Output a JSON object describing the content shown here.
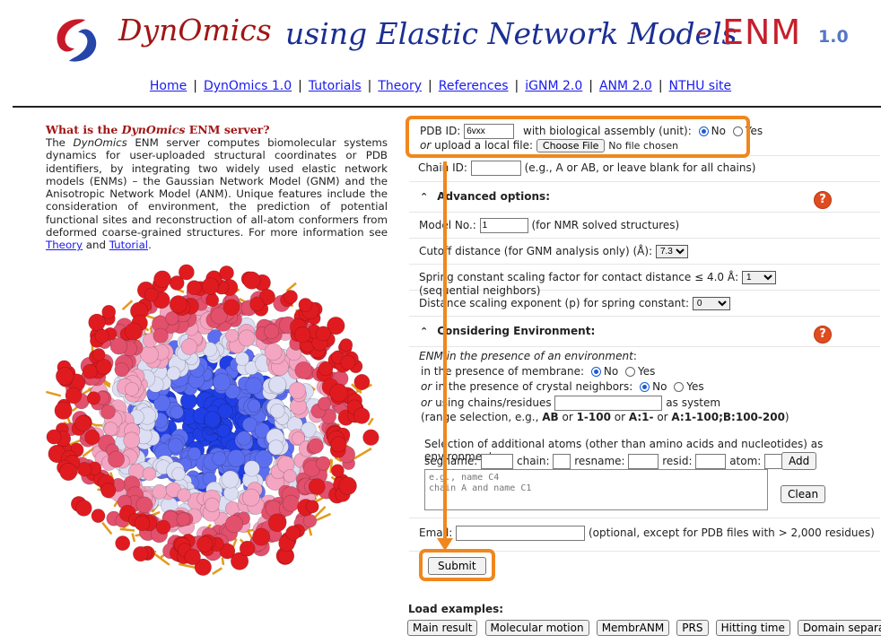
{
  "header": {
    "brand": "DynOmics",
    "subtitle": "using Elastic Network Models",
    "dash": "-",
    "enm_logo": "ENM",
    "version": "1.0",
    "logo_icon": "dynomics-swirl-logo"
  },
  "nav": {
    "links": [
      "Home",
      "DynOmics 1.0",
      "Tutorials",
      "Theory",
      "References",
      "iGNM 2.0",
      "ANM 2.0",
      "NTHU site"
    ],
    "separator": "|"
  },
  "intro": {
    "title_prefix": "What is the ",
    "title_em": "DynOmics",
    "title_suffix": " ENM server?",
    "body_1": "The ",
    "body_em": "DynOmics",
    "body_2": " ENM server computes biomolecular systems dynamics for user-uploaded structural coordinates or PDB identifiers, by integrating two widely used elastic network models (ENMs) – the Gaussian Network Model (GNM) and the Anisotropic Network Model (ANM). Unique features include the consideration of environment, the prediction of potential functional sites and reconstruction of all-atom conformers from deformed coarse-grained structures. For more information see ",
    "theory_link": "Theory",
    "and": " and ",
    "tutorial_link": "Tutorial",
    "period": "."
  },
  "form": {
    "pdb_id_label": "PDB ID:",
    "pdb_id_value": "6vxx",
    "bio_assembly_label": "with biological assembly (unit):",
    "no": "No",
    "yes": "Yes",
    "or": "or",
    "upload_label": "upload a local file:",
    "choose_file": "Choose File",
    "no_file": "No file chosen",
    "chain_id_label": "Chain ID:",
    "chain_id_hint": "(e.g., A or AB, or leave blank for all chains)",
    "advanced_title": "Advanced options:",
    "model_no_label": "Model No.:",
    "model_no_value": "1",
    "model_no_hint": "(for NMR solved structures)",
    "cutoff_label": "Cutoff distance (for GNM analysis only) (Å):",
    "cutoff_value": "7.3",
    "spring_label": "Spring constant scaling factor for contact distance ≤ 4.0 Å:",
    "spring_value": "1",
    "spring_hint": "(sequential neighbors)",
    "exponent_label": "Distance scaling exponent (p) for spring constant:",
    "exponent_value": "0",
    "env_title": "Considering Environment:",
    "env_intro": "ENM in the presence of an environment",
    "env_intro_colon": ":",
    "membrane_label": "in the presence of membrane:",
    "crystal_label": "in the presence of crystal neighbors:",
    "chains_label": "using chains/residues",
    "as_system": "as system",
    "range_1": "(range selection, e.g., ",
    "range_ab": "AB",
    "range_or1": " or ",
    "range_1_100": "1-100",
    "range_or2": " or ",
    "range_a1": "A:1-",
    "range_or3": " or ",
    "range_multi": "A:1-100;B:100-200",
    "range_close": ")",
    "additional_label": "Selection of additional atoms (other than amino acids and nucleotides) as environment:",
    "segname": "segname:",
    "chain": "chain:",
    "resname": "resname:",
    "resid": "resid:",
    "atom": "atom:",
    "add_btn": "Add",
    "clean_btn": "Clean",
    "textarea_placeholder": "e.g., name C4\nchain A and name C1",
    "email_label": "Email:",
    "email_hint": "(optional, except for PDB files with > 2,000 residues)",
    "submit": "Submit"
  },
  "examples": {
    "label": "Load examples:",
    "buttons": [
      "Main result",
      "Molecular motion",
      "MembrANM",
      "PRS",
      "Hitting time",
      "Domain separation"
    ]
  },
  "colors": {
    "highlight": "#f0871e",
    "brand_red": "#a01515",
    "brand_blue": "#1b2f93",
    "link": "#1a1aee",
    "help": "#e04c1f"
  }
}
